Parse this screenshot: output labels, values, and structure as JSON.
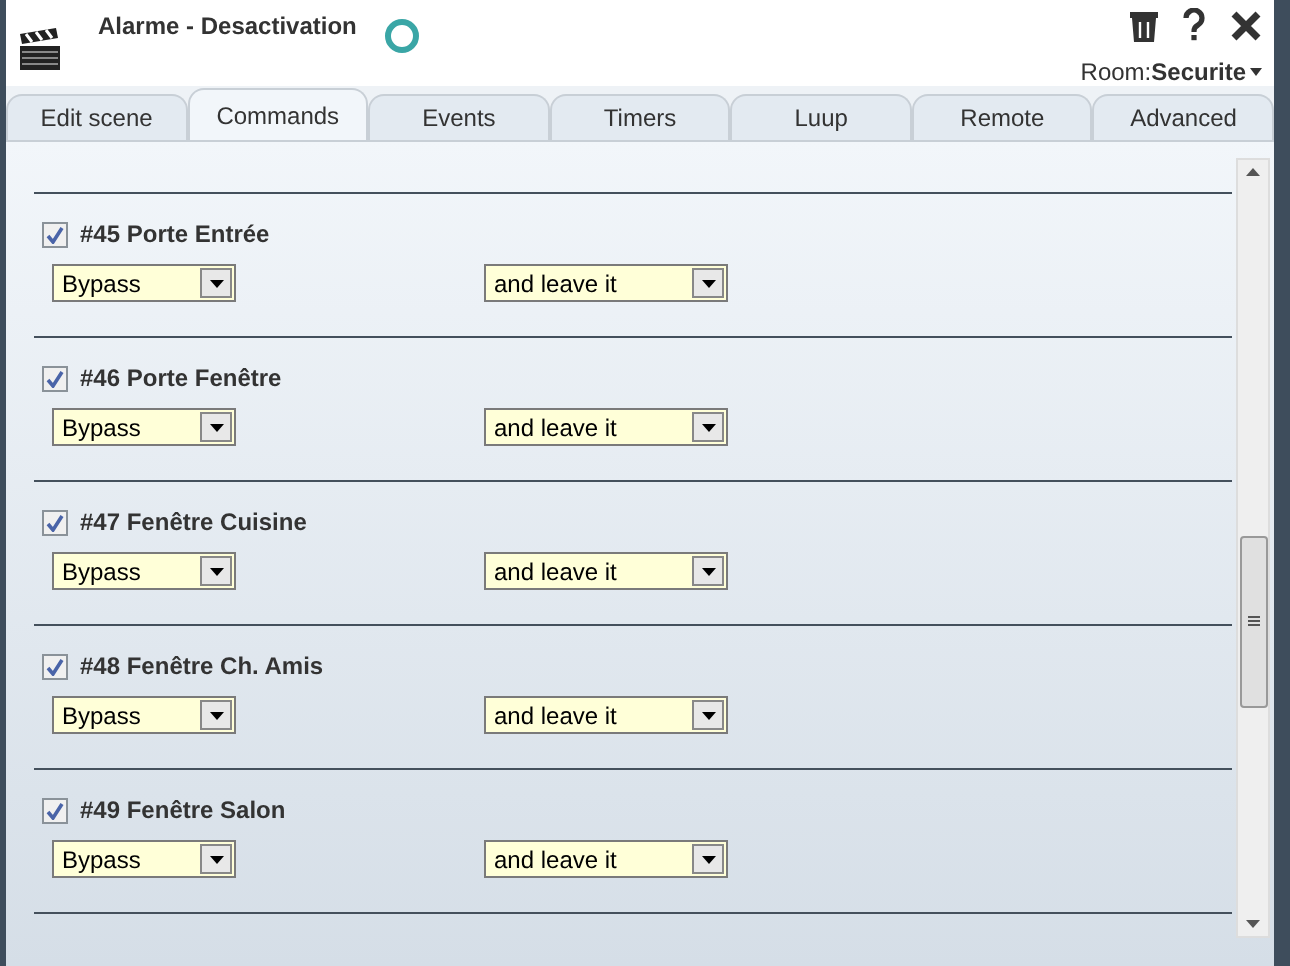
{
  "window": {
    "title": "Alarme - Desactivation",
    "room_label": "Room:",
    "room": "Securite"
  },
  "tabs": [
    {
      "label": "Edit scene",
      "selected": false
    },
    {
      "label": "Commands",
      "selected": true
    },
    {
      "label": "Events",
      "selected": false
    },
    {
      "label": "Timers",
      "selected": false
    },
    {
      "label": "Luup",
      "selected": false
    },
    {
      "label": "Remote",
      "selected": false
    },
    {
      "label": "Advanced",
      "selected": false
    }
  ],
  "devices": [
    {
      "name": "#45 Porte Entrée",
      "checked": true,
      "action": "Bypass",
      "mode": "and leave it"
    },
    {
      "name": "#46 Porte Fenêtre",
      "checked": true,
      "action": "Bypass",
      "mode": "and leave it"
    },
    {
      "name": "#47 Fenêtre Cuisine",
      "checked": true,
      "action": "Bypass",
      "mode": "and leave it"
    },
    {
      "name": "#48 Fenêtre Ch. Amis",
      "checked": true,
      "action": "Bypass",
      "mode": "and leave it"
    },
    {
      "name": "#49 Fenêtre Salon",
      "checked": true,
      "action": "Bypass",
      "mode": "and leave it"
    }
  ]
}
